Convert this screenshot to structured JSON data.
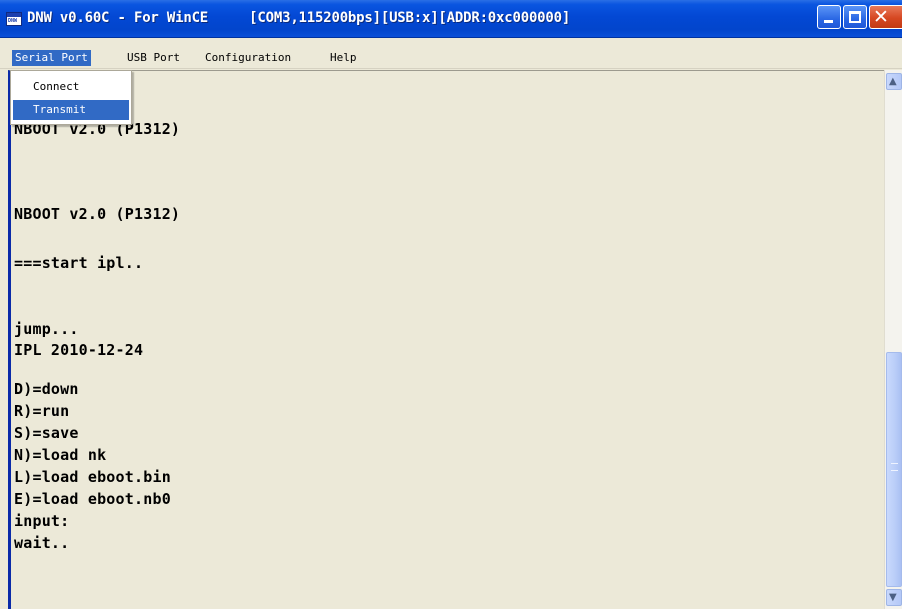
{
  "window": {
    "title": "DNW v0.60C - For WinCE     [COM3,115200bps][USB:x][ADDR:0xc000000]",
    "app_icon": "dnw-app-icon",
    "controls": {
      "minimize_icon": "minimize-icon",
      "maximize_icon": "maximize-icon",
      "close_icon": "close-icon",
      "close_glyph": "✕"
    }
  },
  "menubar": {
    "items": [
      {
        "label": "Serial Port"
      },
      {
        "label": "USB Port"
      },
      {
        "label": "Configuration"
      },
      {
        "label": "Help"
      }
    ]
  },
  "dropdown": {
    "items": [
      {
        "label": "Connect"
      },
      {
        "label": "Transmit"
      }
    ]
  },
  "terminal": {
    "lines": [
      "NBOOT v2.0 (P1312)",
      "NBOOT v2.0 (P1312)",
      "===start ipl..",
      "jump...",
      "IPL 2010-12-24",
      "D)=down",
      "R)=run",
      "S)=save",
      "N)=load nk",
      "L)=load eboot.bin",
      "E)=load eboot.nb0",
      "input:",
      "wait.."
    ]
  },
  "scrollbar": {
    "up_arrow": "▲",
    "down_arrow": "▼"
  },
  "colors": {
    "titlebar": "#0348d4",
    "menu_highlight": "#316ac5",
    "terminal_bg": "#ece9d8",
    "terminal_text": "#000000",
    "close_button": "#d64822"
  }
}
